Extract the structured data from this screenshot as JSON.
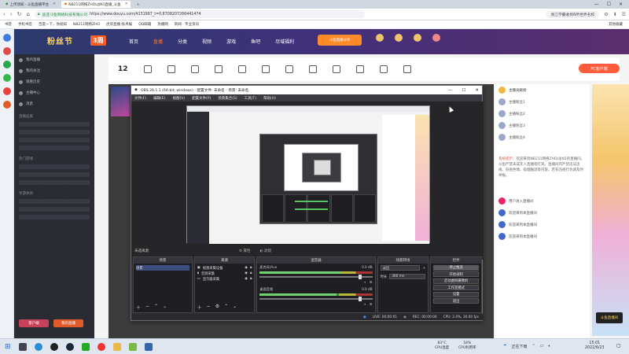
{
  "browser": {
    "tabs": [
      {
        "label": "上传须知 - 斗鱼直播平台",
        "active": false
      },
      {
        "label": "NB211网络ZHOUJIN1直播_斗鱼",
        "active": true
      }
    ],
    "window_controls": [
      "—",
      "☐",
      "✕"
    ],
    "url_site": "迪亚斗鱼网络科技有限公司",
    "url": "https://www.douyu.com/4131997_t=0,8708207266441474",
    "search_engine": "浙江学霸收到6所世界名校",
    "bookmarks": [
      "书签",
      "手机书签",
      "百度一下，你就知",
      "NB211网络ZHO",
      "虎牙直播-技术娱",
      "QQ邮箱",
      "热播网",
      "新闻 · 专业资讯"
    ],
    "bookmarks_right": "其他收藏"
  },
  "douyu": {
    "logo": "粉丝节",
    "logo_badge": "3周",
    "nav": [
      {
        "label": "首页",
        "active": false
      },
      {
        "label": "直播",
        "active": true
      },
      {
        "label": "分类",
        "active": false
      },
      {
        "label": "视频",
        "active": false
      },
      {
        "label": "游戏",
        "active": false
      },
      {
        "label": "鱼吧",
        "active": false
      },
      {
        "label": "尽域福利",
        "active": false
      }
    ],
    "search_button": "斗鱼直播分享",
    "left_nav": {
      "items": [
        "我的直播",
        "我的关注",
        "观看历史",
        "主播中心",
        "消息"
      ],
      "section_1": "直播品类",
      "section_2": "热门游戏",
      "section_3": "手游休闲",
      "btn_1": "客户端",
      "btn_2": "我的直播"
    },
    "toolbar_count": "12",
    "pk_button": "PC客户端",
    "chat": {
      "header": "主播贡献榜",
      "users": [
        "主播粉丝1",
        "主播粉丝2",
        "主播粉丝3",
        "主播粉丝4"
      ],
      "system_msg_label": "系统提示：",
      "system_msg": "欢迎来到NB211网络ZHOUJIN1的直播间，斗鱼严禁未成年人直播或打赏。直播间内严禁违法违规、低俗色情、吸烟酗酒等内容，若有违规行为请及时举报。",
      "entries": [
        "用户进入直播间",
        "欢迎来到本直播间",
        "欢迎来到本直播间",
        "欢迎来到本直播间"
      ]
    },
    "ad_badge": "斗鱼直播间"
  },
  "obs": {
    "title": "OBS 26.1.1 (64-bit, windows) - 配置文件: 未命名 - 场景: 未命名",
    "menu": [
      "文件(F)",
      "编辑(E)",
      "视图(V)",
      "配置文件(P)",
      "场景集合(S)",
      "工具(T)",
      "帮助(H)"
    ],
    "scene_label": "未选择源",
    "preview_controls": [
      "属性",
      "滤镜"
    ],
    "docks": {
      "scenes": {
        "title": "场景",
        "items": [
          "场景"
        ]
      },
      "sources": {
        "title": "来源",
        "items": [
          "视频采集设备",
          "音频采集",
          "显示器采集"
        ]
      },
      "mixer": {
        "title": "混音器",
        "tracks": [
          {
            "name": "麦克风/Aux",
            "db": "0.0 dB",
            "level": 0.72
          },
          {
            "name": "桌面音频",
            "db": "0.0 dB",
            "level": 0.68
          }
        ]
      },
      "transitions": {
        "title": "场景转场",
        "type": "淡出",
        "duration_label": "时长",
        "duration": "300 ms"
      },
      "controls": {
        "title": "控件",
        "buttons": [
          "停止推流",
          "开始录制",
          "启动虚拟摄像机",
          "工作室模式",
          "设置",
          "退出"
        ]
      }
    },
    "status": {
      "live": "LIVE: 00:00:01",
      "rec": "REC: 00:00:00",
      "cpu": "CPU: 2.4%, 30.00 fps"
    }
  },
  "taskbar": {
    "cpu_temp": "83°C",
    "cpu_temp_label": "CPU温度",
    "cpu_usage": "54%",
    "cpu_usage_label": "CPU利用率",
    "status": "正在下雨",
    "time": "15:01",
    "date": "2022/6/23"
  }
}
